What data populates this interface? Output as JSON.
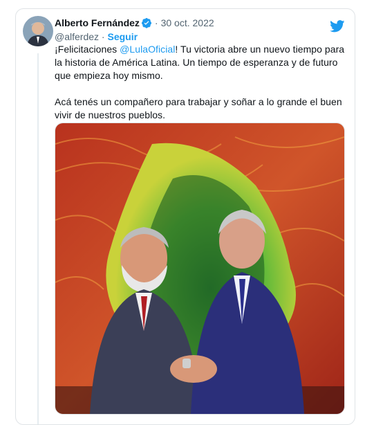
{
  "tweet": {
    "author_name": "Alberto Fernández",
    "handle": "@alferdez",
    "separator": "·",
    "follow_label": "Seguir",
    "date": "30 oct. 2022",
    "text_line1_pre": "¡Felicitaciones ",
    "mention": "@LulaOficial",
    "text_line1_post": "! Tu victoria abre un nuevo tiempo para la historia de América Latina. Un tiempo de esperanza y de futuro que empieza hoy mismo.",
    "text_paragraph2": "Acá tenés un compañero para trabajar y soñar a lo grande el buen vivir de nuestros pueblos."
  },
  "icons": {
    "verified": "verified-badge-icon",
    "platform": "twitter-bird-icon"
  },
  "colors": {
    "accent": "#1d9bf0",
    "secondary_text": "#536471",
    "border": "#dfe3e6"
  }
}
